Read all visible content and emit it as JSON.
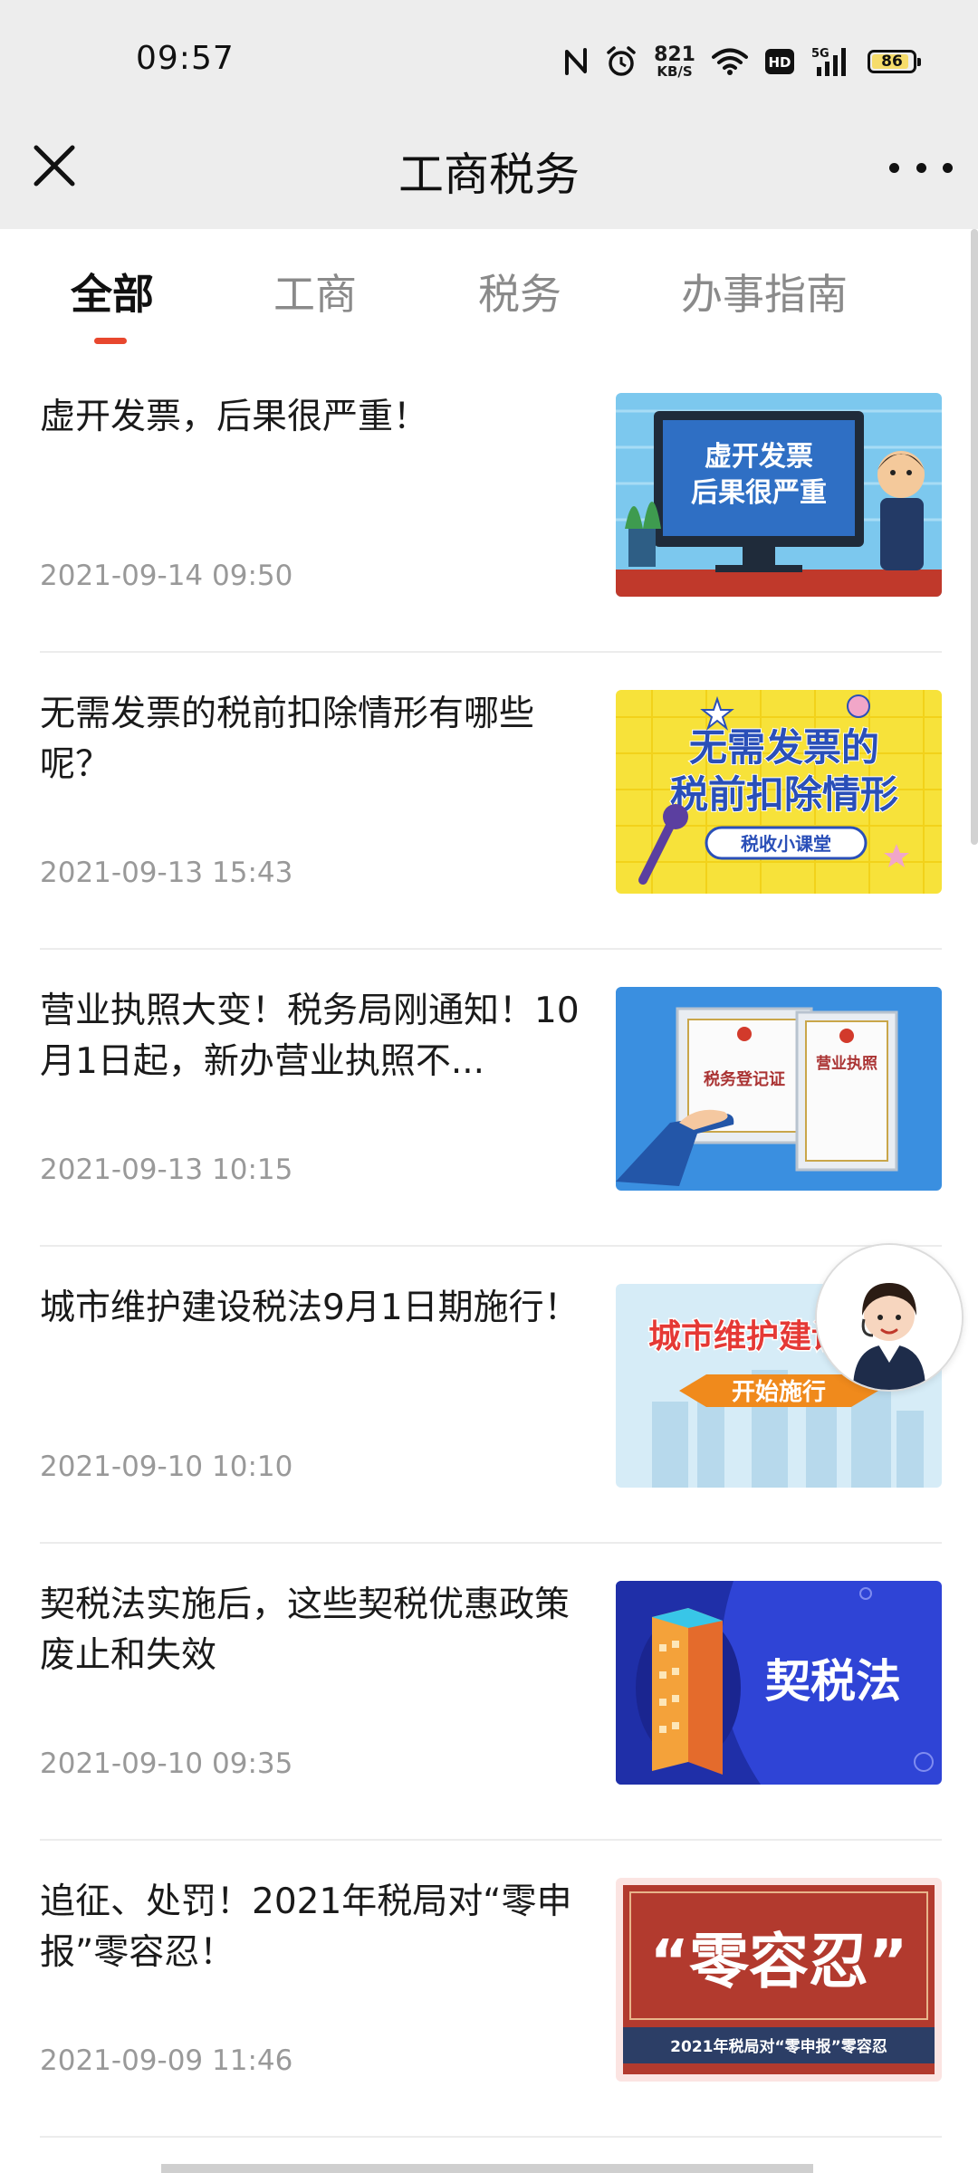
{
  "status_bar": {
    "time": "09:57",
    "net_speed_value": "821",
    "net_speed_unit": "KB/S",
    "hd_label": "HD",
    "signal_label": "5G",
    "battery_level": "86",
    "icons": [
      "nfc-icon",
      "alarm-icon",
      "wifi-icon",
      "hd-icon",
      "signal-icon",
      "battery-icon"
    ]
  },
  "header": {
    "title": "工商税务",
    "close_icon": "close-icon",
    "more_icon": "more-icon"
  },
  "tabs": [
    {
      "label": "全部",
      "active": true
    },
    {
      "label": "工商",
      "active": false
    },
    {
      "label": "税务",
      "active": false
    },
    {
      "label": "办事指南",
      "active": false
    }
  ],
  "accent_color": "#e8472e",
  "articles": [
    {
      "title": "虚开发票，后果很严重！",
      "date": "2021-09-14 09:50",
      "thumb_lines": [
        "虚开发票",
        "后果很严重"
      ]
    },
    {
      "title": "无需发票的税前扣除情形有哪些呢？",
      "date": "2021-09-13 15:43",
      "thumb_lines": [
        "无需发票的",
        "税前扣除情形",
        "税收小课堂"
      ]
    },
    {
      "title": "营业执照大变！税务局刚通知！10月1日起，新办营业执照不...",
      "date": "2021-09-13 10:15",
      "thumb_lines": [
        "税务登记证",
        "营业执照"
      ]
    },
    {
      "title": "城市维护建设税法9月1日期施行！",
      "date": "2021-09-10 10:10",
      "thumb_lines": [
        "城市维护建设税法",
        "开始施行"
      ]
    },
    {
      "title": "契税法实施后，这些契税优惠政策废止和失效",
      "date": "2021-09-10 09:35",
      "thumb_lines": [
        "契税法"
      ]
    },
    {
      "title": "追征、处罚！2021年税局对“零申报”零容忍！",
      "date": "2021-09-09 11:46",
      "thumb_lines": [
        "“零容忍”",
        "2021年税局对“零申报”零容忍"
      ]
    }
  ]
}
